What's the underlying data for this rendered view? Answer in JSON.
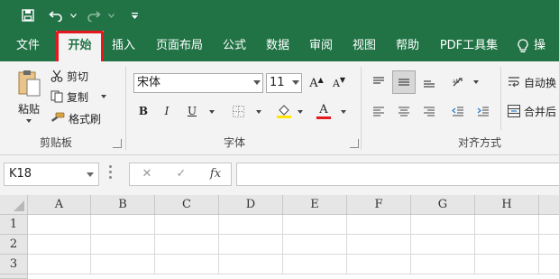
{
  "qat": {
    "save_icon": "save-icon",
    "undo_icon": "undo-icon",
    "redo_icon": "redo-icon",
    "customize_icon": "customize-qat-icon"
  },
  "tabs": [
    {
      "label": "文件",
      "active": false
    },
    {
      "label": "开始",
      "active": true
    },
    {
      "label": "插入",
      "active": false
    },
    {
      "label": "页面布局",
      "active": false
    },
    {
      "label": "公式",
      "active": false
    },
    {
      "label": "数据",
      "active": false
    },
    {
      "label": "审阅",
      "active": false
    },
    {
      "label": "视图",
      "active": false
    },
    {
      "label": "帮助",
      "active": false
    },
    {
      "label": "PDF工具集",
      "active": false
    }
  ],
  "tellme_label": "操",
  "clipboard": {
    "paste_label": "粘贴",
    "cut_label": "剪切",
    "copy_label": "复制",
    "format_painter_label": "格式刷",
    "group_label": "剪贴板"
  },
  "font": {
    "font_name": "宋体",
    "font_size": "11",
    "bold": "B",
    "italic": "I",
    "underline": "U",
    "font_color_glyph": "A",
    "grow_glyph": "A",
    "shrink_glyph": "A",
    "group_label": "字体",
    "fill_color": "#ffe600",
    "text_color": "#e3191f"
  },
  "alignment": {
    "wrap_label": "自动换",
    "merge_label": "合并后",
    "group_label": "对齐方式"
  },
  "formula_bar": {
    "name_box": "K18",
    "cancel_glyph": "✕",
    "enter_glyph": "✓",
    "fx_glyph": "fx",
    "formula": ""
  },
  "grid": {
    "columns": [
      "A",
      "B",
      "C",
      "D",
      "E",
      "F",
      "G",
      "H"
    ],
    "rows": [
      "1",
      "2",
      "3"
    ]
  },
  "colors": {
    "brand": "#217346",
    "highlight": "#e3191f"
  }
}
